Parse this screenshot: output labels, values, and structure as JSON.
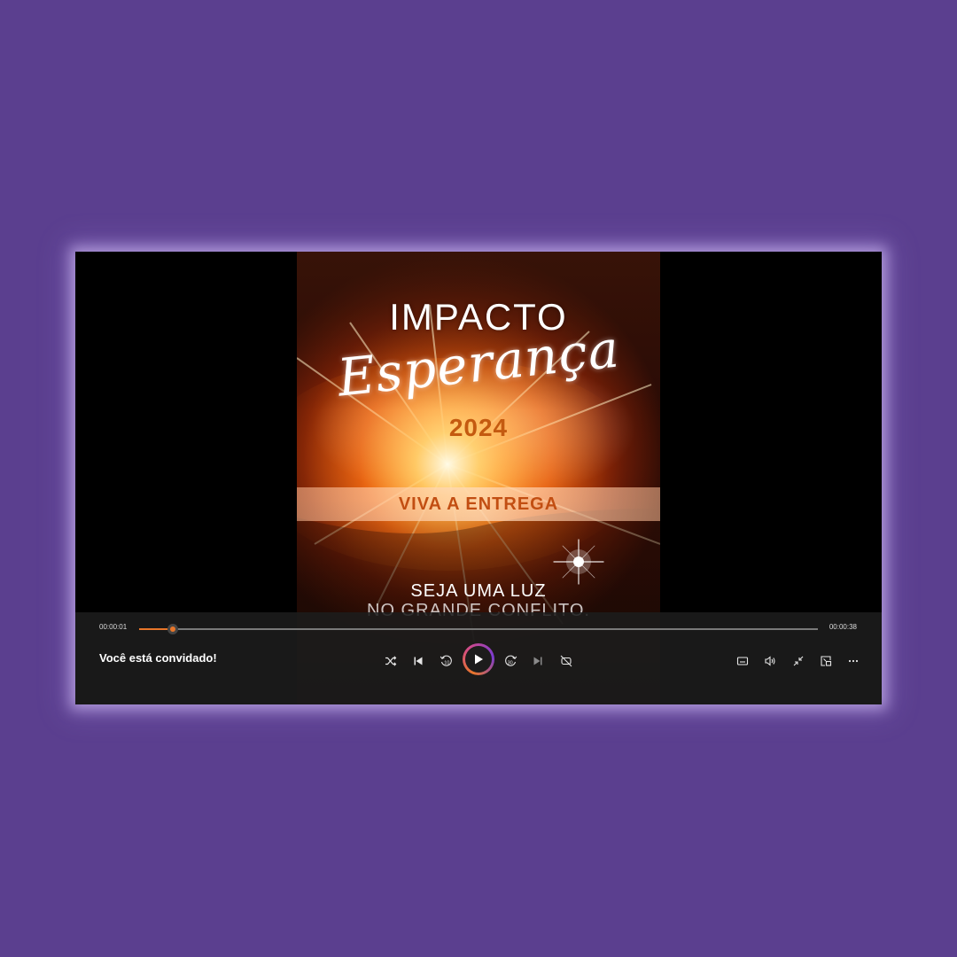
{
  "video": {
    "title_line1": "IMPACTO",
    "title_script": "Esperança",
    "year": "2024",
    "banner": "VIVA A ENTREGA",
    "tagline_line1": "SEJA UMA LUZ",
    "tagline_line2": "NO GRANDE CONFLITO."
  },
  "controls": {
    "current_time": "00:00:01",
    "total_time": "00:00:38",
    "progress": 0.05,
    "media_title": "Você está convidado!",
    "accent_color": "#e8762a",
    "icons": {
      "shuffle": "shuffle-icon",
      "previous": "skip-previous-icon",
      "rewind": "rewind-10-icon",
      "play": "play-icon",
      "forward": "forward-30-icon",
      "next": "skip-next-icon",
      "repeat": "repeat-off-icon",
      "captions": "captions-icon",
      "volume": "volume-icon",
      "exit_fullscreen": "exit-fullscreen-icon",
      "mini_player": "mini-player-icon",
      "more": "more-options-icon"
    }
  },
  "colors": {
    "background": "#5b3f8f",
    "player_bg": "#000000",
    "control_bar": "#1c1c1c"
  }
}
